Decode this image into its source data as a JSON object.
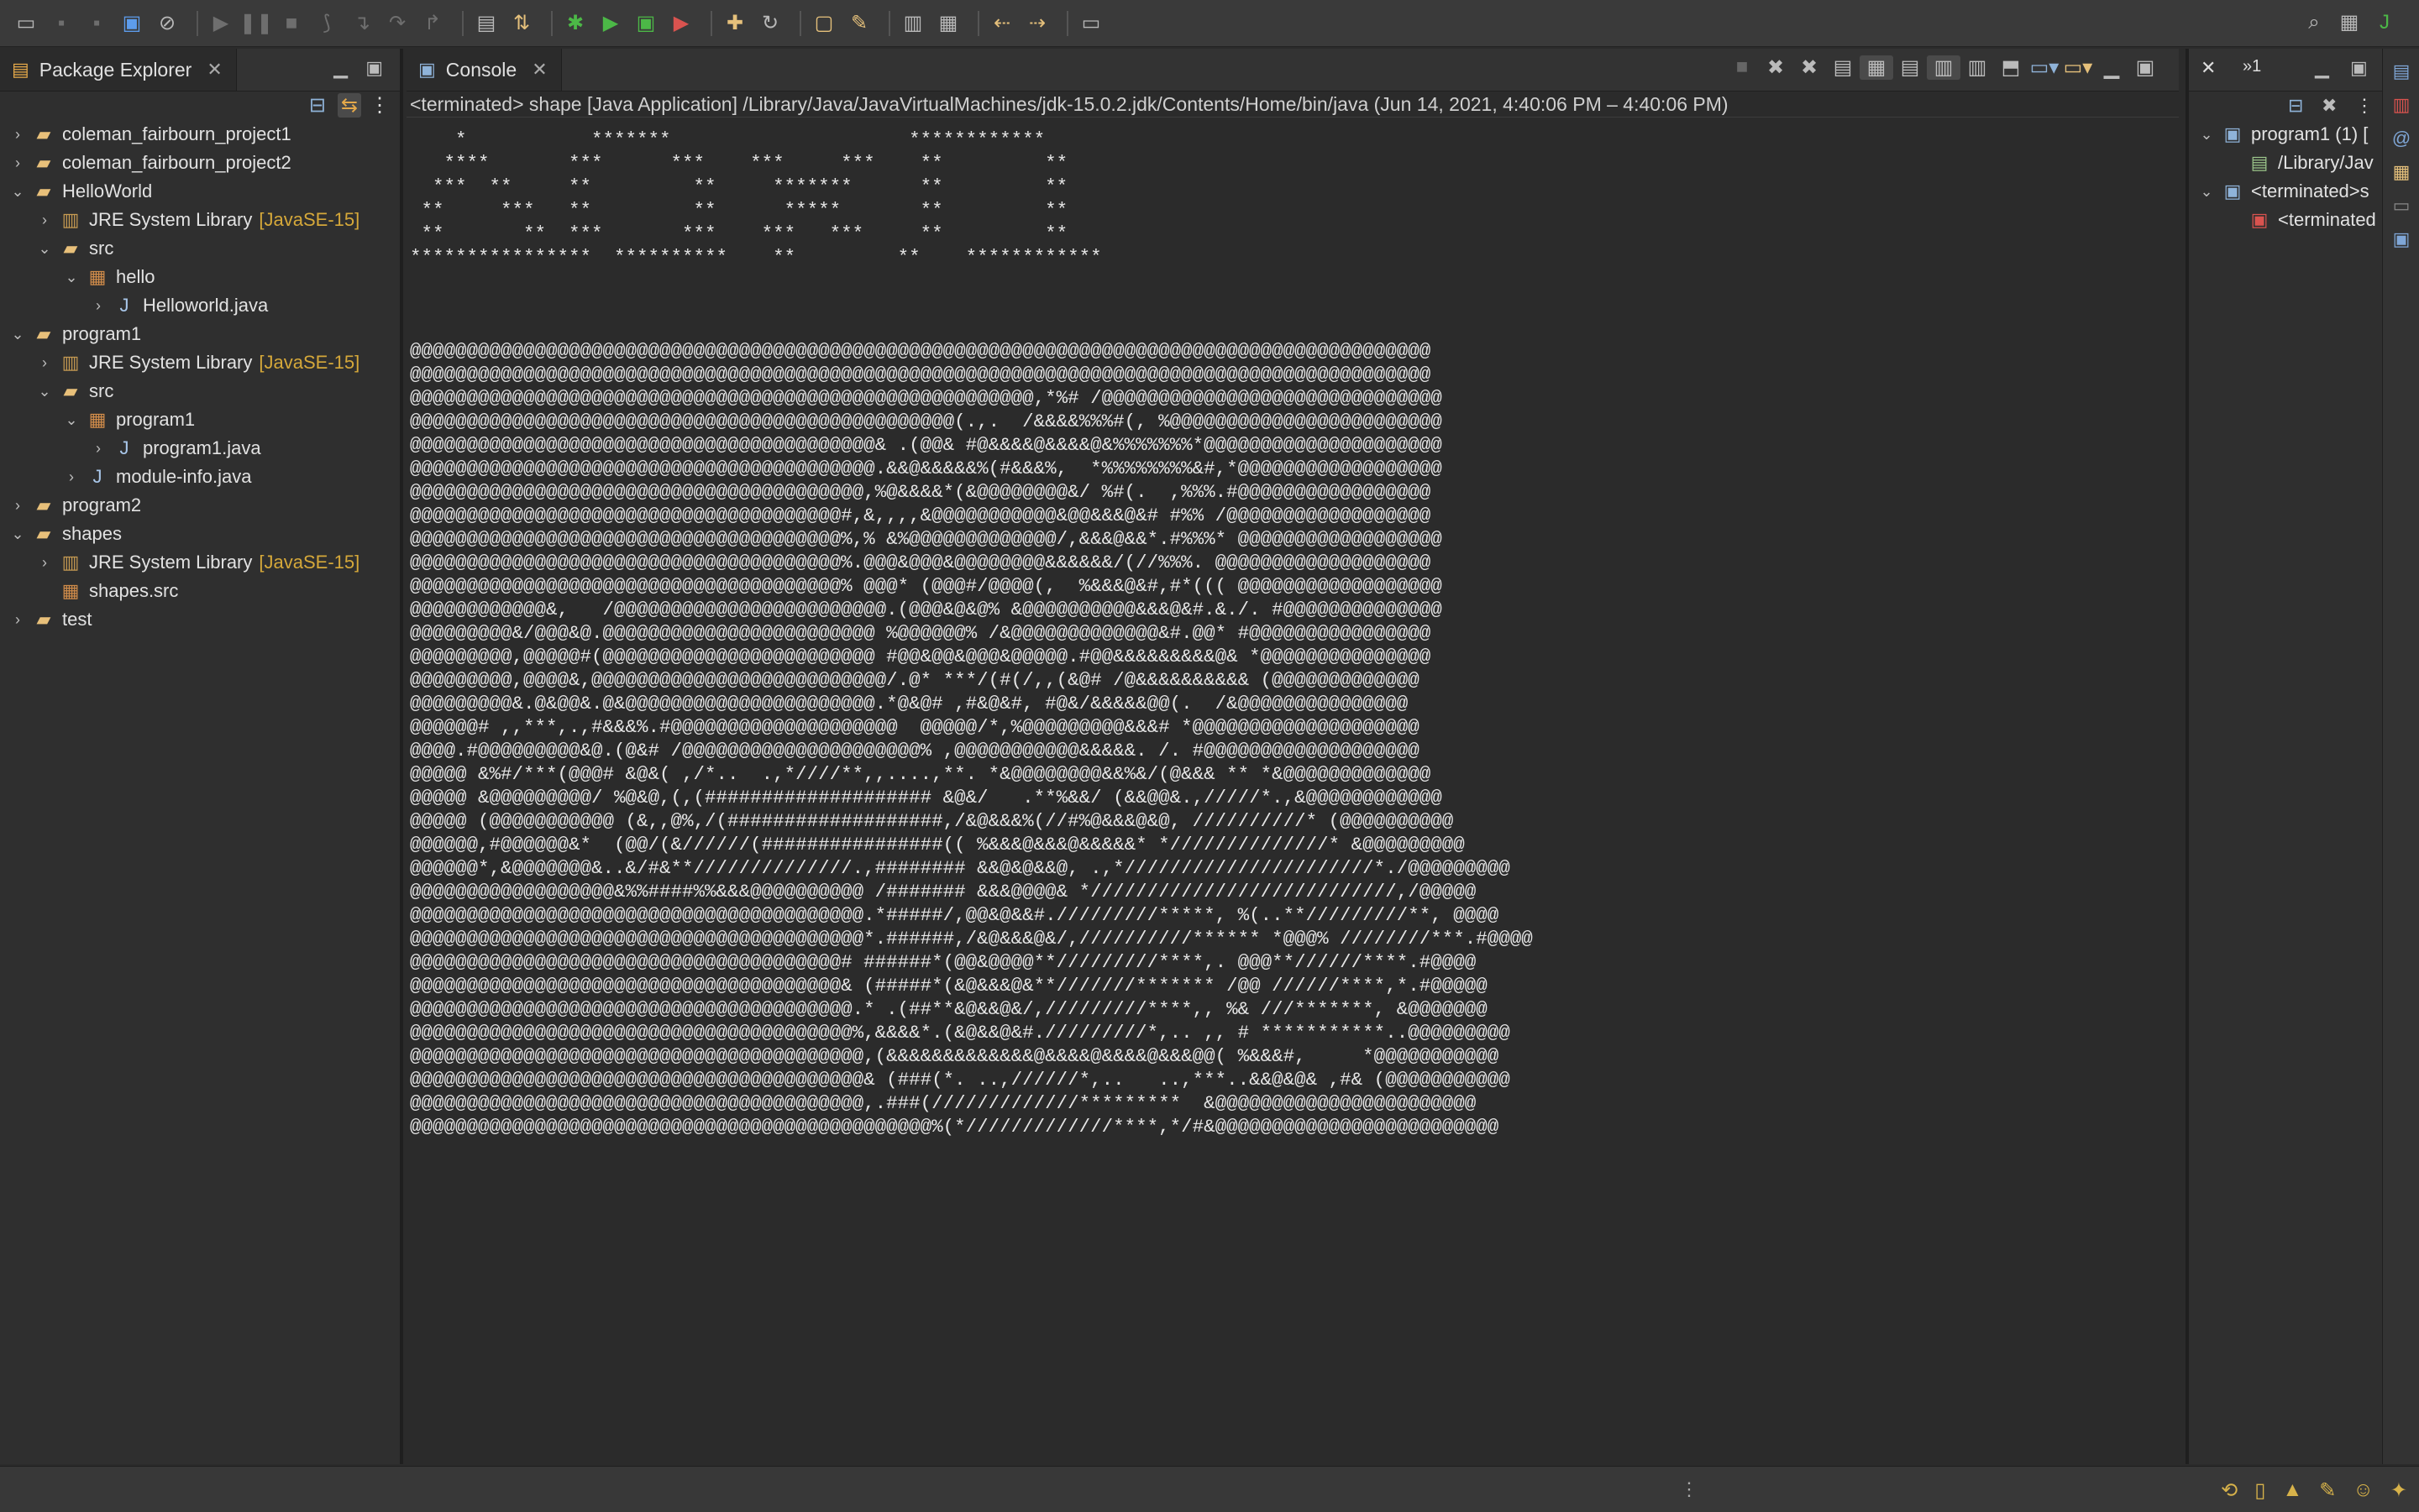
{
  "toolbar": {
    "left_icons": [
      "new-icon",
      "save-icon",
      "save-all-icon",
      "terminal-icon",
      "skip-breakpoints-icon",
      "resume-icon",
      "suspend-icon",
      "terminate-icon",
      "disconnect-icon",
      "step-into-icon",
      "step-over-icon",
      "step-return-icon",
      "open-task-icon",
      "toggle-mark-icon",
      "debug-icon",
      "run-icon",
      "coverage-icon",
      "external-tools-icon",
      "new-java-package-icon",
      "refresh-icon",
      "open-type-icon",
      "highlight-icon",
      "annotation-nav-icon",
      "last-edit-icon",
      "back-icon",
      "forward-icon",
      "pin-icon"
    ],
    "right_icons": [
      "search-icon",
      "open-perspective-icon",
      "java-perspective-icon"
    ]
  },
  "package_explorer": {
    "title": "Package Explorer",
    "tree": [
      {
        "label": "coleman_fairbourn_project1",
        "indent": 0,
        "expanded": false,
        "icon": "project"
      },
      {
        "label": "coleman_fairbourn_project2",
        "indent": 0,
        "expanded": false,
        "icon": "project"
      },
      {
        "label": "HelloWorld",
        "indent": 0,
        "expanded": true,
        "icon": "project"
      },
      {
        "label": "JRE System Library",
        "suffix": "[JavaSE-15]",
        "indent": 1,
        "expanded": false,
        "icon": "library"
      },
      {
        "label": "src",
        "indent": 1,
        "expanded": true,
        "icon": "folder"
      },
      {
        "label": "hello",
        "indent": 2,
        "expanded": true,
        "icon": "package"
      },
      {
        "label": "Helloworld.java",
        "indent": 3,
        "expanded": false,
        "icon": "java"
      },
      {
        "label": "program1",
        "indent": 0,
        "expanded": true,
        "icon": "project"
      },
      {
        "label": "JRE System Library",
        "suffix": "[JavaSE-15]",
        "indent": 1,
        "expanded": false,
        "icon": "library"
      },
      {
        "label": "src",
        "indent": 1,
        "expanded": true,
        "icon": "folder"
      },
      {
        "label": "program1",
        "indent": 2,
        "expanded": true,
        "icon": "package"
      },
      {
        "label": "program1.java",
        "indent": 3,
        "expanded": false,
        "icon": "java"
      },
      {
        "label": "module-info.java",
        "indent": 2,
        "expanded": false,
        "icon": "java"
      },
      {
        "label": "program2",
        "indent": 0,
        "expanded": false,
        "icon": "project"
      },
      {
        "label": "shapes",
        "indent": 0,
        "expanded": true,
        "icon": "project"
      },
      {
        "label": "JRE System Library",
        "suffix": "[JavaSE-15]",
        "indent": 1,
        "expanded": false,
        "icon": "library"
      },
      {
        "label": "shapes.src",
        "indent": 1,
        "expanded": null,
        "icon": "package"
      },
      {
        "label": "test",
        "indent": 0,
        "expanded": false,
        "icon": "project"
      }
    ]
  },
  "console": {
    "title": "Console",
    "terminated_line": "<terminated> shape [Java Application] /Library/Java/JavaVirtualMachines/jdk-15.0.2.jdk/Contents/Home/bin/java  (Jun 14, 2021, 4:40:06 PM – 4:40:06 PM)",
    "output_lines": [
      "    *           *******                     ************",
      "   ****       ***      ***    ***     ***    **         **",
      "  ***  **     **         **     *******      **         **",
      " **     ***   **         **      *****       **         **",
      " **       **  ***       ***    ***   ***     **         **",
      "****************  **********    **         **    ************",
      "",
      "",
      "",
      "@@@@@@@@@@@@@@@@@@@@@@@@@@@@@@@@@@@@@@@@@@@@@@@@@@@@@@@@@@@@@@@@@@@@@@@@@@@@@@@@@@@@@@@@@@",
      "@@@@@@@@@@@@@@@@@@@@@@@@@@@@@@@@@@@@@@@@@@@@@@@@@@@@@@@@@@@@@@@@@@@@@@@@@@@@@@@@@@@@@@@@@@",
      "@@@@@@@@@@@@@@@@@@@@@@@@@@@@@@@@@@@@@@@@@@@@@@@@@@@@@@@,*%# /@@@@@@@@@@@@@@@@@@@@@@@@@@@@@@",
      "@@@@@@@@@@@@@@@@@@@@@@@@@@@@@@@@@@@@@@@@@@@@@@@@(.,.  /&&&&%%%#(, %@@@@@@@@@@@@@@@@@@@@@@@@",
      "@@@@@@@@@@@@@@@@@@@@@@@@@@@@@@@@@@@@@@@@@& .(@@& #@&&&&@&&&&@&%%%%%%%*@@@@@@@@@@@@@@@@@@@@@",
      "@@@@@@@@@@@@@@@@@@@@@@@@@@@@@@@@@@@@@@@@@.&&@&&&&&%(#&&&%,  *%%%%%%%%&#,*@@@@@@@@@@@@@@@@@@",
      "@@@@@@@@@@@@@@@@@@@@@@@@@@@@@@@@@@@@@@@@,%@&&&&*(&@@@@@@@@&/ %#(.  ,%%%.#@@@@@@@@@@@@@@@@@",
      "@@@@@@@@@@@@@@@@@@@@@@@@@@@@@@@@@@@@@@#,&,,,,&@@@@@@@@@@@&@@&&&@&# #%% /@@@@@@@@@@@@@@@@@@",
      "@@@@@@@@@@@@@@@@@@@@@@@@@@@@@@@@@@@@@@%,% &%@@@@@@@@@@@@@/,&&&@&&*.#%%%* @@@@@@@@@@@@@@@@@@",
      "@@@@@@@@@@@@@@@@@@@@@@@@@@@@@@@@@@@@@@%.@@@&@@@&@@@@@@@@&&&&&&/(//%%%. @@@@@@@@@@@@@@@@@@@",
      "@@@@@@@@@@@@@@@@@@@@@@@@@@@@@@@@@@@@@@% @@@* (@@@#/@@@@(,  %&&&@&#,#*((( @@@@@@@@@@@@@@@@@@",
      "@@@@@@@@@@@@&,   /@@@@@@@@@@@@@@@@@@@@@@@@.(@@@&@&@% &@@@@@@@@@@&&&@&#.&./. #@@@@@@@@@@@@@@",
      "@@@@@@@@@&/@@@&@.@@@@@@@@@@@@@@@@@@@@@@@@ %@@@@@@% /&@@@@@@@@@@@@@&#.@@* #@@@@@@@@@@@@@@@@",
      "@@@@@@@@@,@@@@@#(@@@@@@@@@@@@@@@@@@@@@@@@ #@@&@@&@@@&@@@@@.#@@&&&&&&&&&@& *@@@@@@@@@@@@@@@",
      "@@@@@@@@@,@@@@&,@@@@@@@@@@@@@@@@@@@@@@@@@@/.@* ***/(#(/,,(&@# /@&&&&&&&&&& (@@@@@@@@@@@@@",
      "@@@@@@@@@&.@&@@&.@&@@@@@@@@@@@@@@@@@@@@@@.*@&@# ,#&@&#, #@&/&&&&&@@(.  /&@@@@@@@@@@@@@@@",
      "@@@@@@# ,,***,.,#&&&%.#@@@@@@@@@@@@@@@@@@@@  @@@@@/*,%@@@@@@@@@&&&# *@@@@@@@@@@@@@@@@@@@@",
      "@@@@.#@@@@@@@@@&@.(@&# /@@@@@@@@@@@@@@@@@@@@@% ,@@@@@@@@@@@&&&&&. /. #@@@@@@@@@@@@@@@@@@@",
      "@@@@@ &%#/***(@@@# &@&( ,/*..  .,*////**,,....,**. *&@@@@@@@@&&%&/(@&&& ** *&@@@@@@@@@@@@@",
      "@@@@@ &@@@@@@@@@/ %@&@,(,(#################### &@&/   .**%&&/ (&&@@&.,/////*.,&@@@@@@@@@@@@",
      "@@@@@ (@@@@@@@@@@@ (&,,@%,/(###################,/&@&&&%(//#%@&&&@&@, //////////* (@@@@@@@@@@",
      "@@@@@@,#@@@@@@&*  (@@/(&//////(################(( %&&&@&&&@&&&&&* *//////////////* &@@@@@@@@@",
      "@@@@@@*,&@@@@@@@&..&/#&**//////////////.,######## &&@&@&&@, .,*//////////////////////*./@@@@@@@@@",
      "@@@@@@@@@@@@@@@@@@&%%####%%&&&@@@@@@@@@@ /####### &&&@@@@& *///////////////////////////,/@@@@@",
      "@@@@@@@@@@@@@@@@@@@@@@@@@@@@@@@@@@@@@@@@.*#####/,@@&@&&#./////////*****, %(..**/////////**, @@@@",
      "@@@@@@@@@@@@@@@@@@@@@@@@@@@@@@@@@@@@@@@@*.######,/&@&&&@&/,//////////****** *@@@% ////////***.#@@@@",
      "@@@@@@@@@@@@@@@@@@@@@@@@@@@@@@@@@@@@@@# ######*(@@&@@@@**/////////****,. @@@**//////****.#@@@@",
      "@@@@@@@@@@@@@@@@@@@@@@@@@@@@@@@@@@@@@@& (#####*(&@&&&@&**///////******* /@@ //////****,*.#@@@@@",
      "@@@@@@@@@@@@@@@@@@@@@@@@@@@@@@@@@@@@@@@.* .(##**&@&&@&/,/////////****,, %& ///*******, &@@@@@@@",
      "@@@@@@@@@@@@@@@@@@@@@@@@@@@@@@@@@@@@@@@%,&&&&*.(&@&&@&#./////////*,.. ,, # ***********..@@@@@@@@@",
      "@@@@@@@@@@@@@@@@@@@@@@@@@@@@@@@@@@@@@@@@,(&&&&&&&&&&&&&@&&&&@&&&&@&&&@@( %&&&#,     *@@@@@@@@@@@",
      "@@@@@@@@@@@@@@@@@@@@@@@@@@@@@@@@@@@@@@@@& (###(*. ..,//////*,..   ..,***..&&@&@& ,#& (@@@@@@@@@@@",
      "@@@@@@@@@@@@@@@@@@@@@@@@@@@@@@@@@@@@@@@@,.###(/////////////*********  &@@@@@@@@@@@@@@@@@@@@@@@",
      "@@@@@@@@@@@@@@@@@@@@@@@@@@@@@@@@@@@@@@@@@@@@@@%(*/////////////****,*/#&@@@@@@@@@@@@@@@@@@@@@@@@@"
    ]
  },
  "debug_view": {
    "tab_label": "»1",
    "rows": [
      {
        "label": "program1 (1) [",
        "indent": 0,
        "expanded": true,
        "icon": "java-app"
      },
      {
        "label": "/Library/Jav",
        "indent": 1,
        "expanded": null,
        "icon": "process"
      },
      {
        "label": "<terminated>s",
        "indent": 0,
        "expanded": true,
        "icon": "java-app"
      },
      {
        "label": "<terminated",
        "indent": 1,
        "expanded": null,
        "icon": "terminated"
      }
    ]
  },
  "status_bar": {
    "icons": [
      "progress-icon",
      "book-icon",
      "tutorial-icon",
      "tip-icon",
      "smiley-icon",
      "lightbulb-icon"
    ]
  }
}
